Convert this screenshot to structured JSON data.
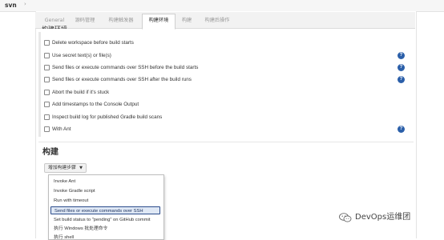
{
  "header": {
    "project": "svn",
    "separator": "›"
  },
  "tabs": [
    {
      "label": "General",
      "active": false
    },
    {
      "label": "源码管理",
      "active": false
    },
    {
      "label": "构建触发器",
      "active": false
    },
    {
      "label": "构建环境",
      "active": true
    },
    {
      "label": "构建",
      "active": false
    },
    {
      "label": "构建后操作",
      "active": false
    }
  ],
  "environment": {
    "options": [
      {
        "label": "Delete workspace before build starts",
        "checked": false,
        "help": false
      },
      {
        "label": "Use secret text(s) or file(s)",
        "checked": false,
        "help": true
      },
      {
        "label": "Send files or execute commands over SSH before the build starts",
        "checked": false,
        "help": true
      },
      {
        "label": "Send files or execute commands over SSH after the build runs",
        "checked": false,
        "help": true
      },
      {
        "label": "Abort the build if it's stuck",
        "checked": false,
        "help": false
      },
      {
        "label": "Add timestamps to the Console Output",
        "checked": false,
        "help": false
      },
      {
        "label": "Inspect build log for published Gradle build scans",
        "checked": false,
        "help": false
      },
      {
        "label": "With Ant",
        "checked": false,
        "help": true
      }
    ],
    "help_glyph": "?"
  },
  "build": {
    "heading": "构建",
    "add_step_label": "增加构建步骤",
    "add_step_caret": "▼",
    "menu_items": [
      {
        "label": "Invoke Ant",
        "highlighted": false
      },
      {
        "label": "Invoke Gradle script",
        "highlighted": false
      },
      {
        "label": "Run with timeout",
        "highlighted": false
      },
      {
        "label": "Send files or execute commands over SSH",
        "highlighted": true
      },
      {
        "label": "Set build status to \"pending\" on GitHub commit",
        "highlighted": false
      },
      {
        "label": "执行 Windows 批处理命令",
        "highlighted": false
      },
      {
        "label": "执行 shell",
        "highlighted": false
      }
    ]
  },
  "watermark": {
    "text": "DevOps运维团"
  },
  "colors": {
    "accent": "#2b5fa9",
    "highlight_border": "#2a4b8a",
    "highlight_bg": "#dfe8f5"
  }
}
